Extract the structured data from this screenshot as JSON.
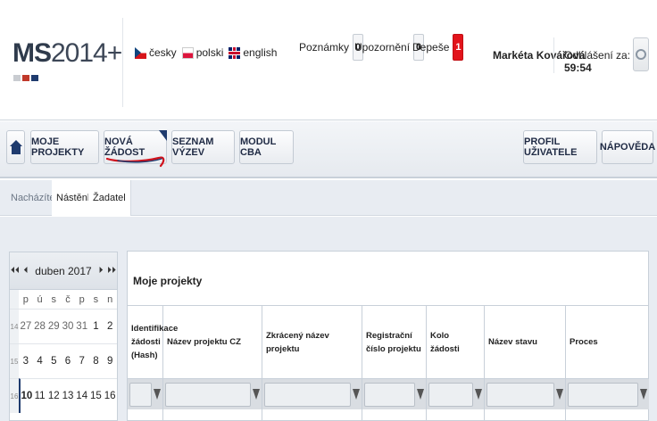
{
  "brand": {
    "logo_bold": "MS",
    "logo_thin": "2014+",
    "square_colors": [
      "#c9ccd1",
      "#c0392b",
      "#1f3b6e"
    ]
  },
  "languages": [
    {
      "label": "česky",
      "icon": "flag-cz-icon"
    },
    {
      "label": "polski",
      "icon": "flag-pl-icon"
    },
    {
      "label": "english",
      "icon": "flag-en-icon"
    }
  ],
  "notifications": [
    {
      "label": "Poznámky",
      "count": "0"
    },
    {
      "label": "Upozornění",
      "count": "0"
    },
    {
      "label": "Depeše",
      "count": "1"
    }
  ],
  "user": {
    "name": "Markéta Kovářová",
    "logout_label": "Odhlášení za:",
    "logout_time": "59:54"
  },
  "nav": {
    "home_icon": "home-icon",
    "moje_projekty": "MOJE PROJEKTY",
    "nova_zadost": "NOVÁ ŽÁDOST",
    "seznam_vyzev": "SEZNAM VÝZEV",
    "modul_cba": "MODUL CBA",
    "profil": "PROFIL UŽIVATELE",
    "napoveda": "NÁPOVĚDA"
  },
  "breadcrumb": {
    "label": "Nacházíte se:",
    "items": [
      "Nástěnka",
      "Žadatel"
    ]
  },
  "calendar": {
    "title": "duben 2017",
    "day_names": [
      "p",
      "ú",
      "s",
      "č",
      "p",
      "s",
      "n"
    ],
    "weeks": [
      {
        "wk": "14",
        "days": [
          "27",
          "28",
          "29",
          "30",
          "31",
          "1",
          "2"
        ]
      },
      {
        "wk": "15",
        "days": [
          "3",
          "4",
          "5",
          "6",
          "7",
          "8",
          "9"
        ]
      },
      {
        "wk": "16",
        "days": [
          "10",
          "11",
          "12",
          "13",
          "14",
          "15",
          "16"
        ]
      }
    ]
  },
  "projects": {
    "title": "Moje projekty",
    "columns": [
      "Identifikace žádosti (Hash)",
      "Název projektu CZ",
      "Zkrácený název projektu",
      "Registrační číslo projektu",
      "Kolo žádosti",
      "Název stavu",
      "Proces"
    ]
  }
}
